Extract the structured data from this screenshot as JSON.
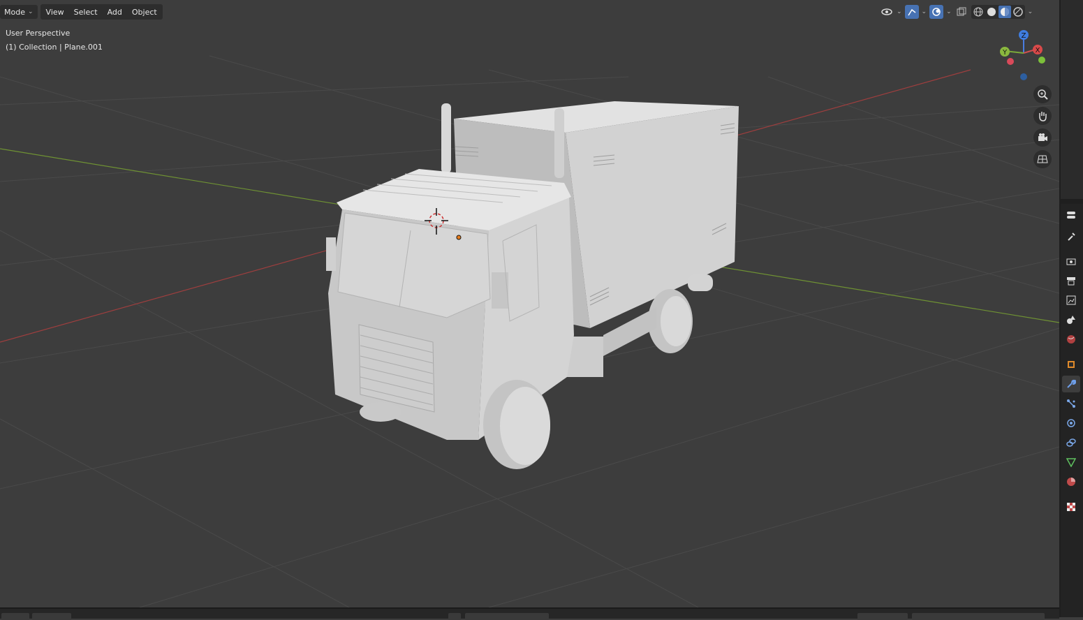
{
  "header": {
    "mode_label": "Mode",
    "menus": [
      "View",
      "Select",
      "Add",
      "Object"
    ]
  },
  "overlay": {
    "perspective": "User Perspective",
    "collection": "(1) Collection | Plane.001"
  },
  "gizmo": {
    "z_label": "Z",
    "y_label": "Y",
    "x_label": "X"
  },
  "colors": {
    "background": "#3d3d3d",
    "x_axis": "#c04a4a",
    "y_axis": "#7ca83a",
    "accent": "#4772b3",
    "model": "#c9c9c9"
  },
  "icons": {
    "nav": [
      "zoom-icon",
      "hand-pan-icon",
      "camera-icon",
      "grid-ortho-icon"
    ],
    "properties_tabs": [
      "tool-icon",
      "render-icon",
      "output-icon",
      "view-layer-icon",
      "scene-icon",
      "world-icon",
      "object-icon",
      "modifier-icon",
      "particles-icon",
      "physics-icon",
      "constraints-icon",
      "data-icon",
      "material-icon",
      "texture-icon"
    ]
  }
}
